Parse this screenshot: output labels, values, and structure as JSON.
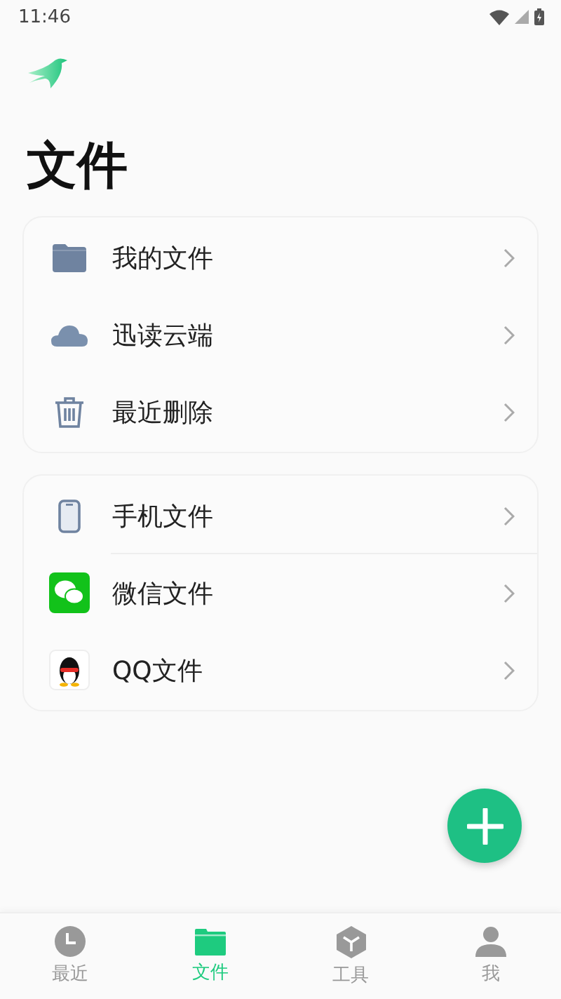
{
  "status_bar": {
    "time": "11:46"
  },
  "title": "文件",
  "groups": [
    {
      "rows": [
        {
          "label": "我的文件",
          "kind": "folder"
        },
        {
          "label": "迅读云端",
          "kind": "cloud"
        },
        {
          "label": "最近删除",
          "kind": "trash"
        }
      ]
    },
    {
      "rows": [
        {
          "label": "手机文件",
          "kind": "phone"
        },
        {
          "label": "微信文件",
          "kind": "chat"
        },
        {
          "label": "QQ文件",
          "kind": "penguin"
        }
      ]
    }
  ],
  "nav": [
    {
      "label": "最近",
      "kind": "clock",
      "selected": false
    },
    {
      "label": "文件",
      "kind": "folder",
      "selected": true
    },
    {
      "label": "工具",
      "kind": "cube",
      "selected": false
    },
    {
      "label": "我",
      "kind": "person",
      "selected": false
    }
  ]
}
